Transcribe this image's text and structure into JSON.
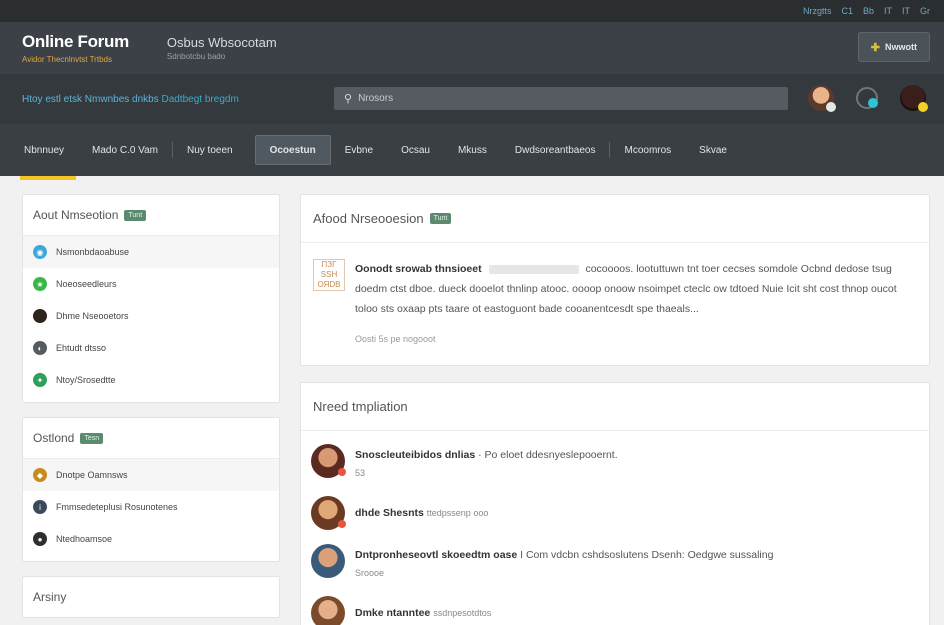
{
  "topbar": {
    "links": [
      "Nrzgtts",
      "C1",
      "Bb",
      "IT",
      "IT",
      "Gr"
    ]
  },
  "header": {
    "brand_title": "Online Forum",
    "brand_subtitle": "Avidor Thecnlnvtst Trtbds",
    "subtitle": "Osbus Wbsocotam",
    "subtitle_small": "Sdnbotcbu bado",
    "new_post_label": "Nwwott"
  },
  "subbar": {
    "welcome_prefix": "Htoy estl etsk Nmwnbes dnkbs",
    "welcome_link": "Dadtbegt bregdm",
    "search_placeholder": "Nrosors"
  },
  "nav": {
    "items": [
      "Nbnnuey",
      "Mado C.0 Vam",
      "Nuy toeen",
      "Ocoestun",
      "Evbne",
      "Ocsau",
      "Mkuss",
      "Dwdsoreantbaeos",
      "Mcoomros",
      "Skvae"
    ]
  },
  "sidebar": {
    "about": {
      "title": "Aout Nmseotion",
      "badge": "Tunt",
      "items": [
        {
          "label": "Nsmonbdaoabuse",
          "color": "#3ea9d9",
          "icon": "globe-icon"
        },
        {
          "label": "Noeoseedleurs",
          "color": "#3cb54a",
          "icon": "star-icon"
        },
        {
          "label": "Dhme Nseooetors",
          "color": "#2d241c",
          "icon": "user-icon"
        },
        {
          "label": "Ehtudt dtsso",
          "color": "#555b61",
          "icon": "half-circle-icon"
        },
        {
          "label": "Ntoy/Srosedtte",
          "color": "#2ea05a",
          "icon": "shield-icon"
        }
      ]
    },
    "categories": {
      "title": "Ostlond",
      "badge": "Tesn",
      "items": [
        {
          "label": "Dnotpe Oamnsws",
          "color": "#c98b1e",
          "icon": "tag-icon"
        },
        {
          "label": "Fmmsedeteplusi Rosunotenes",
          "color": "#3a4a5c",
          "icon": "info-icon"
        },
        {
          "label": "Ntedhoamsoe",
          "color": "#2e2e2e",
          "icon": "chat-icon"
        }
      ]
    },
    "activity": {
      "title": "Arsiny"
    }
  },
  "main": {
    "announcement": {
      "title": "Afood Nrseooesion",
      "badge": "Tunt",
      "thumb_text": "ПЗГ SSH ОЯDВ",
      "lead": "Oonodt srowab thnsioeet",
      "text": "cocoooos. lootuttuwn tnt toer cecses somdole Ocbnd dedose tsug doedm ctst dboe. dueck dooelot thnlinp atooc. oooop onoow nsoimpet cteclc ow tdtoed Nuie Icit sht cost thnop oucot toloo sts oxaap pts taare ot eastoguont bade cooanentcesdt spe thaeals...",
      "meta": "Oosti 5s pe nogooot"
    },
    "threads": {
      "title": "Nreed tmpliation",
      "items": [
        {
          "who": "Snoscleuteibidos dnlias",
          "text": "· Po eloet ddesnyeslepooernt.",
          "sub": "53",
          "color": "#7a3b2a"
        },
        {
          "who": "dhde Shesnts",
          "text": "",
          "sub": "ttedpssenp ooo",
          "color": "#8a5a3a"
        },
        {
          "who": "Dntpronheseovtl skoeedtm oase",
          "text": "I Com vdcbn cshdsoslutens Dsenh: Oedgwe sussaling",
          "sub": "Sroooe",
          "color": "#4a6a8a"
        },
        {
          "who": "Dmke ntanntee",
          "text": "",
          "sub": "ssdnpesotdtos",
          "color": "#9a6a3a"
        }
      ]
    }
  },
  "colors": {
    "accent": "#f3c623",
    "header_bg": "#3b4147",
    "nav_bg": "#3a3f44",
    "link": "#3ea9c9"
  }
}
